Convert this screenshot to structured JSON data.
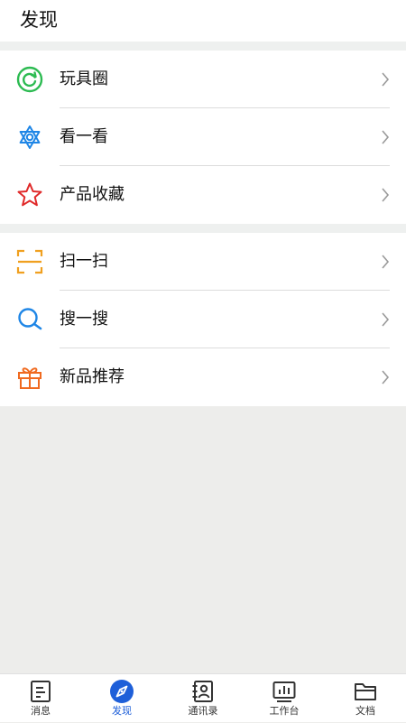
{
  "header": {
    "title": "发现"
  },
  "groups": [
    {
      "items": [
        {
          "label": "玩具圈",
          "icon": "circle-refresh-icon",
          "color": "#2dbb52"
        },
        {
          "label": "看一看",
          "icon": "hexagram-star-icon",
          "color": "#1f86e6"
        },
        {
          "label": "产品收藏",
          "icon": "star-outline-icon",
          "color": "#e02a2a"
        }
      ]
    },
    {
      "items": [
        {
          "label": "扫一扫",
          "icon": "scan-icon",
          "color": "#f0a020"
        },
        {
          "label": "搜一搜",
          "icon": "search-icon",
          "color": "#1f86e6"
        },
        {
          "label": "新品推荐",
          "icon": "gift-icon",
          "color": "#f06a20"
        }
      ]
    }
  ],
  "tabbar": {
    "active_index": 1,
    "active_color": "#1e5fd9",
    "items": [
      {
        "label": "消息",
        "icon": "message-icon"
      },
      {
        "label": "发现",
        "icon": "compass-icon"
      },
      {
        "label": "通讯录",
        "icon": "contacts-icon"
      },
      {
        "label": "工作台",
        "icon": "workbench-icon"
      },
      {
        "label": "文档",
        "icon": "folder-icon"
      }
    ]
  }
}
